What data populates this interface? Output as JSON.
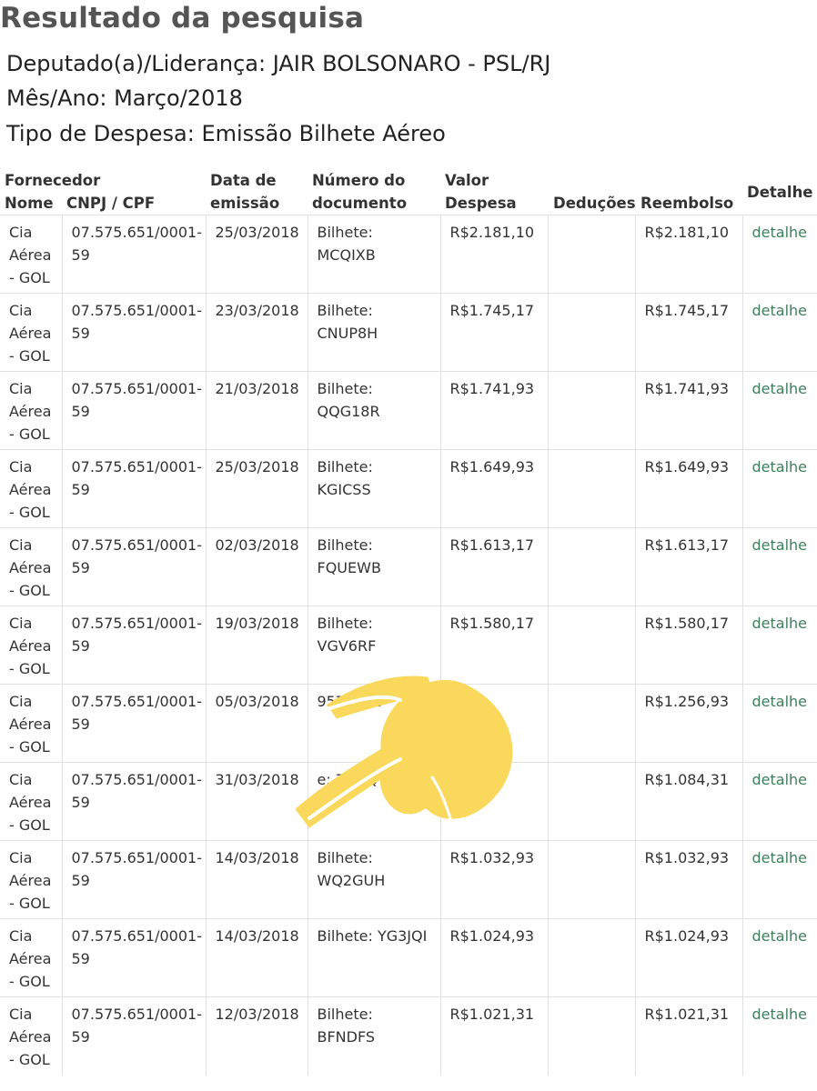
{
  "page": {
    "title": "Resultado da pesquisa",
    "deputado": "Deputado(a)/Liderança: JAIR BOLSONARO - PSL/RJ",
    "mes_ano": "Mês/Ano: Março/2018",
    "tipo": "Tipo de Despesa: Emissão Bilhete Aéreo"
  },
  "table": {
    "headers": {
      "fornecedor": "Fornecedor",
      "nome": "Nome",
      "cnpj": "CNPJ / CPF",
      "data_1": "Data de",
      "data_2": "emissão",
      "numero_1": "Número do",
      "numero_2": "documento",
      "valor_1": "Valor",
      "valor_2": "Despesa",
      "deducoes": "Deduções",
      "reembolso": "Reembolso",
      "detalhe": "Detalhe"
    },
    "rows": [
      {
        "nome": "Cia Aérea - GOL",
        "cnpj": "07.575.651/0001-59",
        "data": "25/03/2018",
        "doc": "Bilhete: MCQIXB",
        "valor": "R$2.181,10",
        "deducoes": "",
        "reembolso": "R$2.181,10",
        "detalhe": "detalhe"
      },
      {
        "nome": "Cia Aérea - GOL",
        "cnpj": "07.575.651/0001-59",
        "data": "23/03/2018",
        "doc": "Bilhete: CNUP8H",
        "valor": "R$1.745,17",
        "deducoes": "",
        "reembolso": "R$1.745,17",
        "detalhe": "detalhe"
      },
      {
        "nome": "Cia Aérea - GOL",
        "cnpj": "07.575.651/0001-59",
        "data": "21/03/2018",
        "doc": "Bilhete: QQG18R",
        "valor": "R$1.741,93",
        "deducoes": "",
        "reembolso": "R$1.741,93",
        "detalhe": "detalhe"
      },
      {
        "nome": "Cia Aérea - GOL",
        "cnpj": "07.575.651/0001-59",
        "data": "25/03/2018",
        "doc": "Bilhete: KGICSS",
        "valor": "R$1.649,93",
        "deducoes": "",
        "reembolso": "R$1.649,93",
        "detalhe": "detalhe"
      },
      {
        "nome": "Cia Aérea - GOL",
        "cnpj": "07.575.651/0001-59",
        "data": "02/03/2018",
        "doc": "Bilhete: FQUEWB",
        "valor": "R$1.613,17",
        "deducoes": "",
        "reembolso": "R$1.613,17",
        "detalhe": "detalhe"
      },
      {
        "nome": "Cia Aérea - GOL",
        "cnpj": "07.575.651/0001-59",
        "data": "19/03/2018",
        "doc": "Bilhete: VGV6RF",
        "valor": "R$1.580,17",
        "deducoes": "",
        "reembolso": "R$1.580,17",
        "detalhe": "detalhe"
      },
      {
        "nome": "Cia Aérea - GOL",
        "cnpj": "07.575.651/0001-59",
        "data": "05/03/2018",
        "doc": "9572162",
        "valor": "93",
        "deducoes": "",
        "reembolso": "R$1.256,93",
        "detalhe": "detalhe"
      },
      {
        "nome": "Cia Aérea - GOL",
        "cnpj": "07.575.651/0001-59",
        "data": "31/03/2018",
        "doc": "e: 7M4Q",
        "valor": ",31",
        "deducoes": "",
        "reembolso": "R$1.084,31",
        "detalhe": "detalhe"
      },
      {
        "nome": "Cia Aérea - GOL",
        "cnpj": "07.575.651/0001-59",
        "data": "14/03/2018",
        "doc": "Bilhete: WQ2GUH",
        "valor": "R$1.032,93",
        "deducoes": "",
        "reembolso": "R$1.032,93",
        "detalhe": "detalhe"
      },
      {
        "nome": "Cia Aérea - GOL",
        "cnpj": "07.575.651/0001-59",
        "data": "14/03/2018",
        "doc": "Bilhete: YG3JQI",
        "valor": "R$1.024,93",
        "deducoes": "",
        "reembolso": "R$1.024,93",
        "detalhe": "detalhe"
      },
      {
        "nome": "Cia Aérea - GOL",
        "cnpj": "07.575.651/0001-59",
        "data": "12/03/2018",
        "doc": "Bilhete: BFNDFS",
        "valor": "R$1.021,31",
        "deducoes": "",
        "reembolso": "R$1.021,31",
        "detalhe": "detalhe"
      }
    ]
  },
  "colors": {
    "title": "#555555",
    "link": "#3d7f5a",
    "finger_emoji": "#f9d85c"
  },
  "overlay": {
    "icon": "pointing-finger-emoji"
  }
}
